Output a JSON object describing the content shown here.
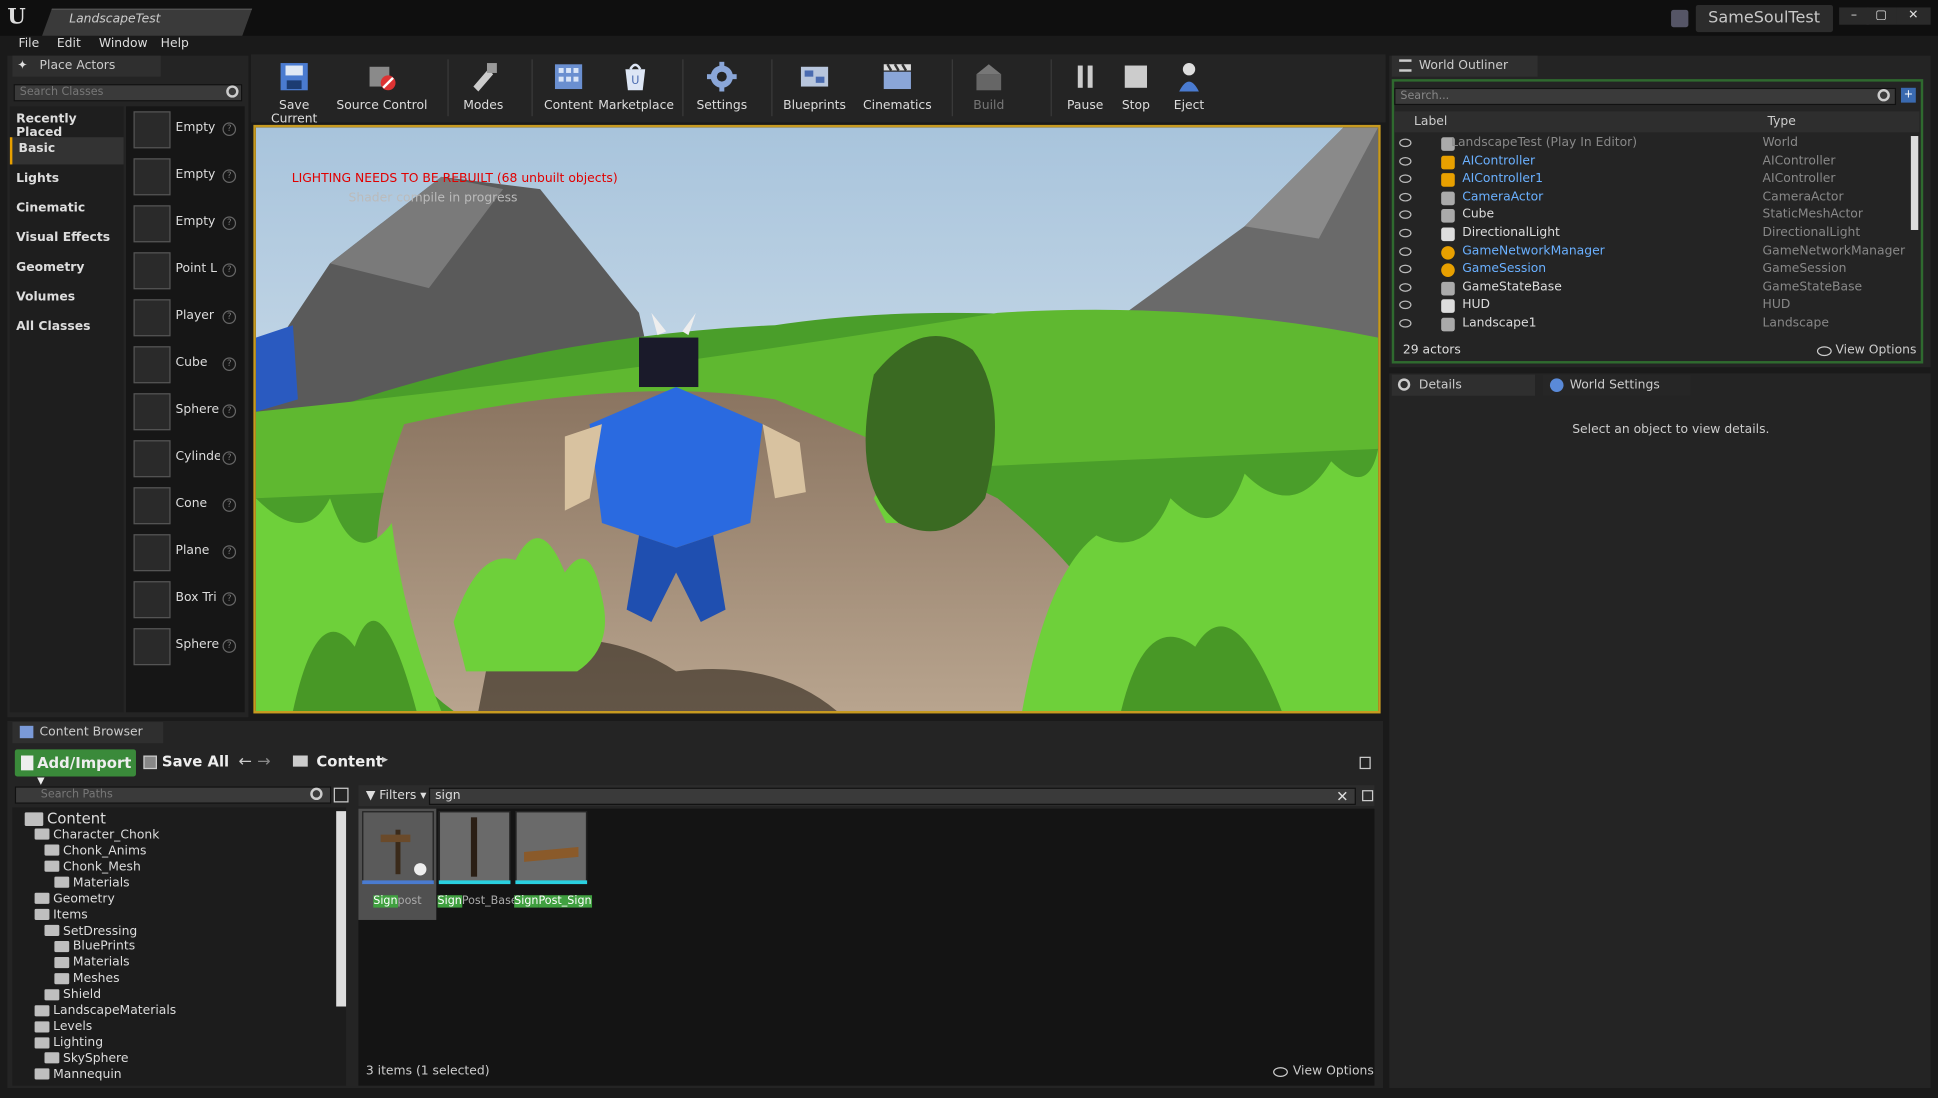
{
  "window": {
    "doc_tab": "LandscapeTest",
    "project_name": "SameSoulTest"
  },
  "menu": [
    "File",
    "Edit",
    "Window",
    "Help"
  ],
  "place_actors": {
    "tab": "Place Actors",
    "search_placeholder": "Search Classes",
    "categories": [
      "Recently Placed",
      "Basic",
      "Lights",
      "Cinematic",
      "Visual Effects",
      "Geometry",
      "Volumes",
      "All Classes"
    ],
    "actors": [
      "Empty",
      "Empty",
      "Empty",
      "Point L",
      "Player",
      "Cube",
      "Sphere",
      "Cylinde",
      "Cone",
      "Plane",
      "Box Tri",
      "Sphere"
    ]
  },
  "toolbar": [
    "Save Current",
    "Source Control",
    "Modes",
    "Content",
    "Marketplace",
    "Settings",
    "Blueprints",
    "Cinematics",
    "Build",
    "Pause",
    "Stop",
    "Eject"
  ],
  "viewport": {
    "lighting_warning": "LIGHTING NEEDS TO BE REBUILT (68 unbuilt objects)",
    "sub_text": "Shader compile in progress"
  },
  "world_outliner": {
    "tab": "World Outliner",
    "search_placeholder": "Search...",
    "col_label": "Label",
    "col_type": "Type",
    "rows": [
      {
        "label": "LandscapeTest (Play In Editor)",
        "type": "World"
      },
      {
        "label": "AIController",
        "type": "AIController"
      },
      {
        "label": "AIController1",
        "type": "AIController"
      },
      {
        "label": "CameraActor",
        "type": "CameraActor"
      },
      {
        "label": "Cube",
        "type": "StaticMeshActor"
      },
      {
        "label": "DirectionalLight",
        "type": "DirectionalLight"
      },
      {
        "label": "GameNetworkManager",
        "type": "GameNetworkManager"
      },
      {
        "label": "GameSession",
        "type": "GameSession"
      },
      {
        "label": "GameStateBase",
        "type": "GameStateBase"
      },
      {
        "label": "HUD",
        "type": "HUD"
      },
      {
        "label": "Landscape1",
        "type": "Landscape"
      }
    ],
    "actor_count": "29 actors",
    "view_options": "View Options"
  },
  "details": {
    "tab": "Details",
    "tab2": "World Settings",
    "empty_msg": "Select an object to view details."
  },
  "content_browser": {
    "tab": "Content Browser",
    "add_import": "Add/Import",
    "save_all": "Save All",
    "path": "Content",
    "paths_placeholder": "Search Paths",
    "filters": "Filters",
    "search_value": "sign",
    "tree": [
      {
        "label": "Content",
        "level": 0
      },
      {
        "label": "Character_Chonk",
        "level": 1
      },
      {
        "label": "Chonk_Anims",
        "level": 2
      },
      {
        "label": "Chonk_Mesh",
        "level": 2
      },
      {
        "label": "Materials",
        "level": 3
      },
      {
        "label": "Geometry",
        "level": 1
      },
      {
        "label": "Items",
        "level": 1
      },
      {
        "label": "SetDressing",
        "level": 2
      },
      {
        "label": "BluePrints",
        "level": 3
      },
      {
        "label": "Materials",
        "level": 3
      },
      {
        "label": "Meshes",
        "level": 3
      },
      {
        "label": "Shield",
        "level": 2
      },
      {
        "label": "LandscapeMaterials",
        "level": 1
      },
      {
        "label": "Levels",
        "level": 1
      },
      {
        "label": "Lighting",
        "level": 1
      },
      {
        "label": "SkySphere",
        "level": 2
      },
      {
        "label": "Mannequin",
        "level": 1
      }
    ],
    "assets": [
      {
        "match": "Sign",
        "rest": "post"
      },
      {
        "match": "Sign",
        "rest": "Post_Base"
      },
      {
        "match": "Sign",
        "rest": "Post_Sign"
      }
    ],
    "item_count": "3 items (1 selected)",
    "view_options": "View Options"
  }
}
